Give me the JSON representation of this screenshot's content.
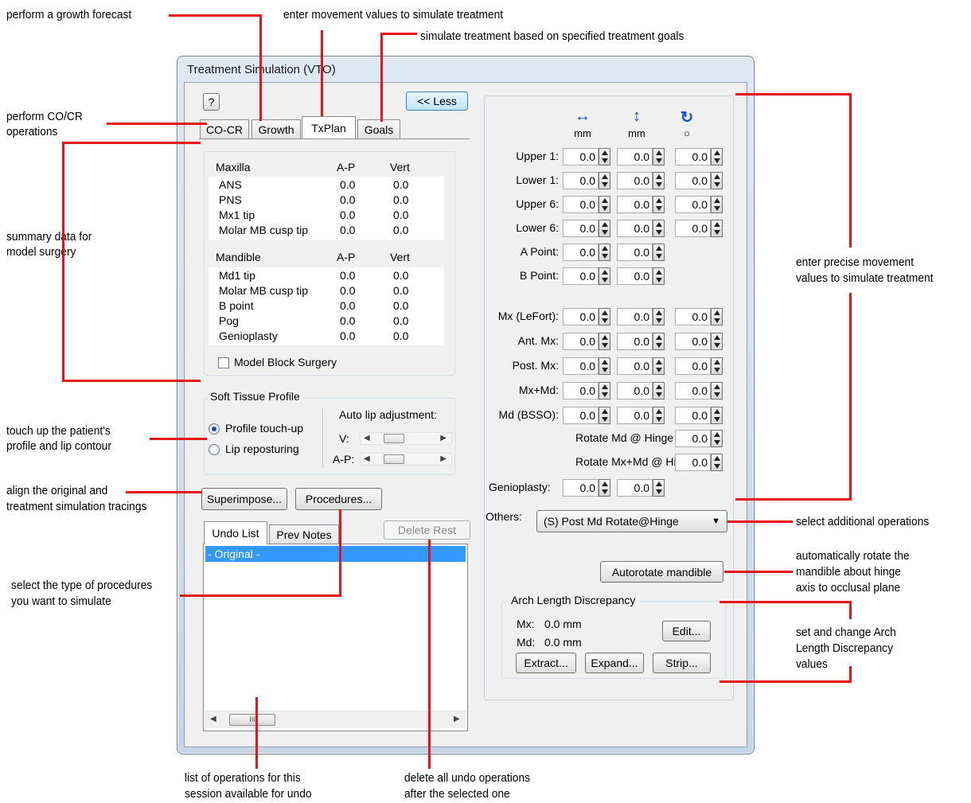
{
  "annotations": {
    "growth": "perform a growth forecast",
    "txplan": "enter movement values to simulate treatment",
    "goals": "simulate treatment based on specified treatment goals",
    "cocr_1": "perform CO/CR",
    "cocr_2": "operations",
    "summary_1": "summary data for",
    "summary_2": "model surgery",
    "profile_1": "touch up the patient's",
    "profile_2": "profile and lip contour",
    "superimpose_1": "align the original and",
    "superimpose_2": "treatment simulation tracings",
    "procedures_1": "select the type of procedures",
    "procedures_2": "you want to simulate",
    "undo_1": "list of operations for this",
    "undo_2": "session available for undo",
    "delete_1": "delete all undo operations",
    "delete_2": "after the selected one",
    "precise_1": "enter precise movement",
    "precise_2": "values to simulate treatment",
    "others": "select additional operations",
    "autorotate_1": "automatically rotate the",
    "autorotate_2": "mandible about hinge",
    "autorotate_3": "axis to occlusal plane",
    "arch_1": "set and change Arch",
    "arch_2": "Length Discrepancy",
    "arch_3": "values"
  },
  "window": {
    "title": "Treatment Simulation (VTO)",
    "help_label": "?",
    "less_label": "<< Less"
  },
  "tabs": [
    "CO-CR",
    "Growth",
    "TxPlan",
    "Goals"
  ],
  "active_tab": "TxPlan",
  "summary": {
    "maxilla": {
      "header": [
        "Maxilla",
        "A-P",
        "Vert"
      ],
      "rows": [
        [
          "ANS",
          "0.0",
          "0.0"
        ],
        [
          "PNS",
          "0.0",
          "0.0"
        ],
        [
          "Mx1 tip",
          "0.0",
          "0.0"
        ],
        [
          "Molar MB cusp tip",
          "0.0",
          "0.0"
        ]
      ]
    },
    "mandible": {
      "header": [
        "Mandible",
        "A-P",
        "Vert"
      ],
      "rows": [
        [
          "Md1 tip",
          "0.0",
          "0.0"
        ],
        [
          "Molar MB cusp tip",
          "0.0",
          "0.0"
        ],
        [
          "B point",
          "0.0",
          "0.0"
        ],
        [
          "Pog",
          "0.0",
          "0.0"
        ],
        [
          "Genioplasty",
          "0.0",
          "0.0"
        ]
      ]
    },
    "model_block_label": "Model Block Surgery",
    "model_block_checked": false
  },
  "soft_tissue": {
    "title": "Soft Tissue Profile",
    "options": [
      "Profile touch-up",
      "Lip reposturing"
    ],
    "selected": "Profile touch-up",
    "auto_lip_label": "Auto lip adjustment:",
    "v_label": "V:",
    "ap_label": "A-P:",
    "v_level": 0.2,
    "ap_level": 0.2
  },
  "buttons": {
    "superimpose": "Superimpose...",
    "procedures": "Procedures...",
    "delete_rest": "Delete Rest",
    "autorotate": "Autorotate mandible",
    "edit": "Edit...",
    "extract": "Extract...",
    "expand": "Expand...",
    "strip": "Strip..."
  },
  "undo": {
    "tabs": [
      "Undo List",
      "Prev Notes"
    ],
    "items": [
      "- Original -"
    ],
    "scroll_glyph": "III"
  },
  "movement": {
    "columns": [
      {
        "icon": "horizontal-arrow-icon",
        "glyph": "↔",
        "unit": "mm"
      },
      {
        "icon": "vertical-arrow-icon",
        "glyph": "↕",
        "unit": "mm"
      },
      {
        "icon": "rotate-icon",
        "glyph": "↻",
        "unit": "○"
      }
    ],
    "teeth": [
      {
        "label": "Upper 1:",
        "values": [
          "0.0",
          "0.0",
          "0.0"
        ]
      },
      {
        "label": "Lower 1:",
        "values": [
          "0.0",
          "0.0",
          "0.0"
        ]
      },
      {
        "label": "Upper 6:",
        "values": [
          "0.0",
          "0.0",
          "0.0"
        ]
      },
      {
        "label": "Lower 6:",
        "values": [
          "0.0",
          "0.0",
          "0.0"
        ]
      },
      {
        "label": "A Point:",
        "values": [
          "0.0",
          "0.0"
        ]
      },
      {
        "label": "B Point:",
        "values": [
          "0.0",
          "0.0"
        ]
      }
    ],
    "jaws": [
      {
        "label": "Mx (LeFort):",
        "values": [
          "0.0",
          "0.0",
          "0.0"
        ]
      },
      {
        "label": "Ant. Mx:",
        "values": [
          "0.0",
          "0.0",
          "0.0"
        ]
      },
      {
        "label": "Post. Mx:",
        "values": [
          "0.0",
          "0.0",
          "0.0"
        ]
      },
      {
        "label": "Mx+Md:",
        "values": [
          "0.0",
          "0.0",
          "0.0"
        ]
      },
      {
        "label": "Md (BSSO):",
        "values": [
          "0.0",
          "0.0",
          "0.0"
        ]
      }
    ],
    "rotate_md_label": "Rotate Md @ Hinge Axis:",
    "rotate_md_value": "0.0",
    "rotate_mxmd_label": "Rotate Mx+Md @ Hinge Axis:",
    "rotate_mxmd_value": "0.0",
    "genioplasty_label": "Genioplasty:",
    "genioplasty_values": [
      "0.0",
      "0.0"
    ],
    "others_label": "Others:",
    "others_value": "(S) Post Md Rotate@Hinge"
  },
  "arch": {
    "title": "Arch Length Discrepancy",
    "mx_label": "Mx:",
    "mx_value": "0.0 mm",
    "md_label": "Md:",
    "md_value": "0.0 mm"
  },
  "colors": {
    "annotation_line": "#e8141c",
    "selection": "#3399ff",
    "arrow_blue": "#1a4fd0"
  }
}
